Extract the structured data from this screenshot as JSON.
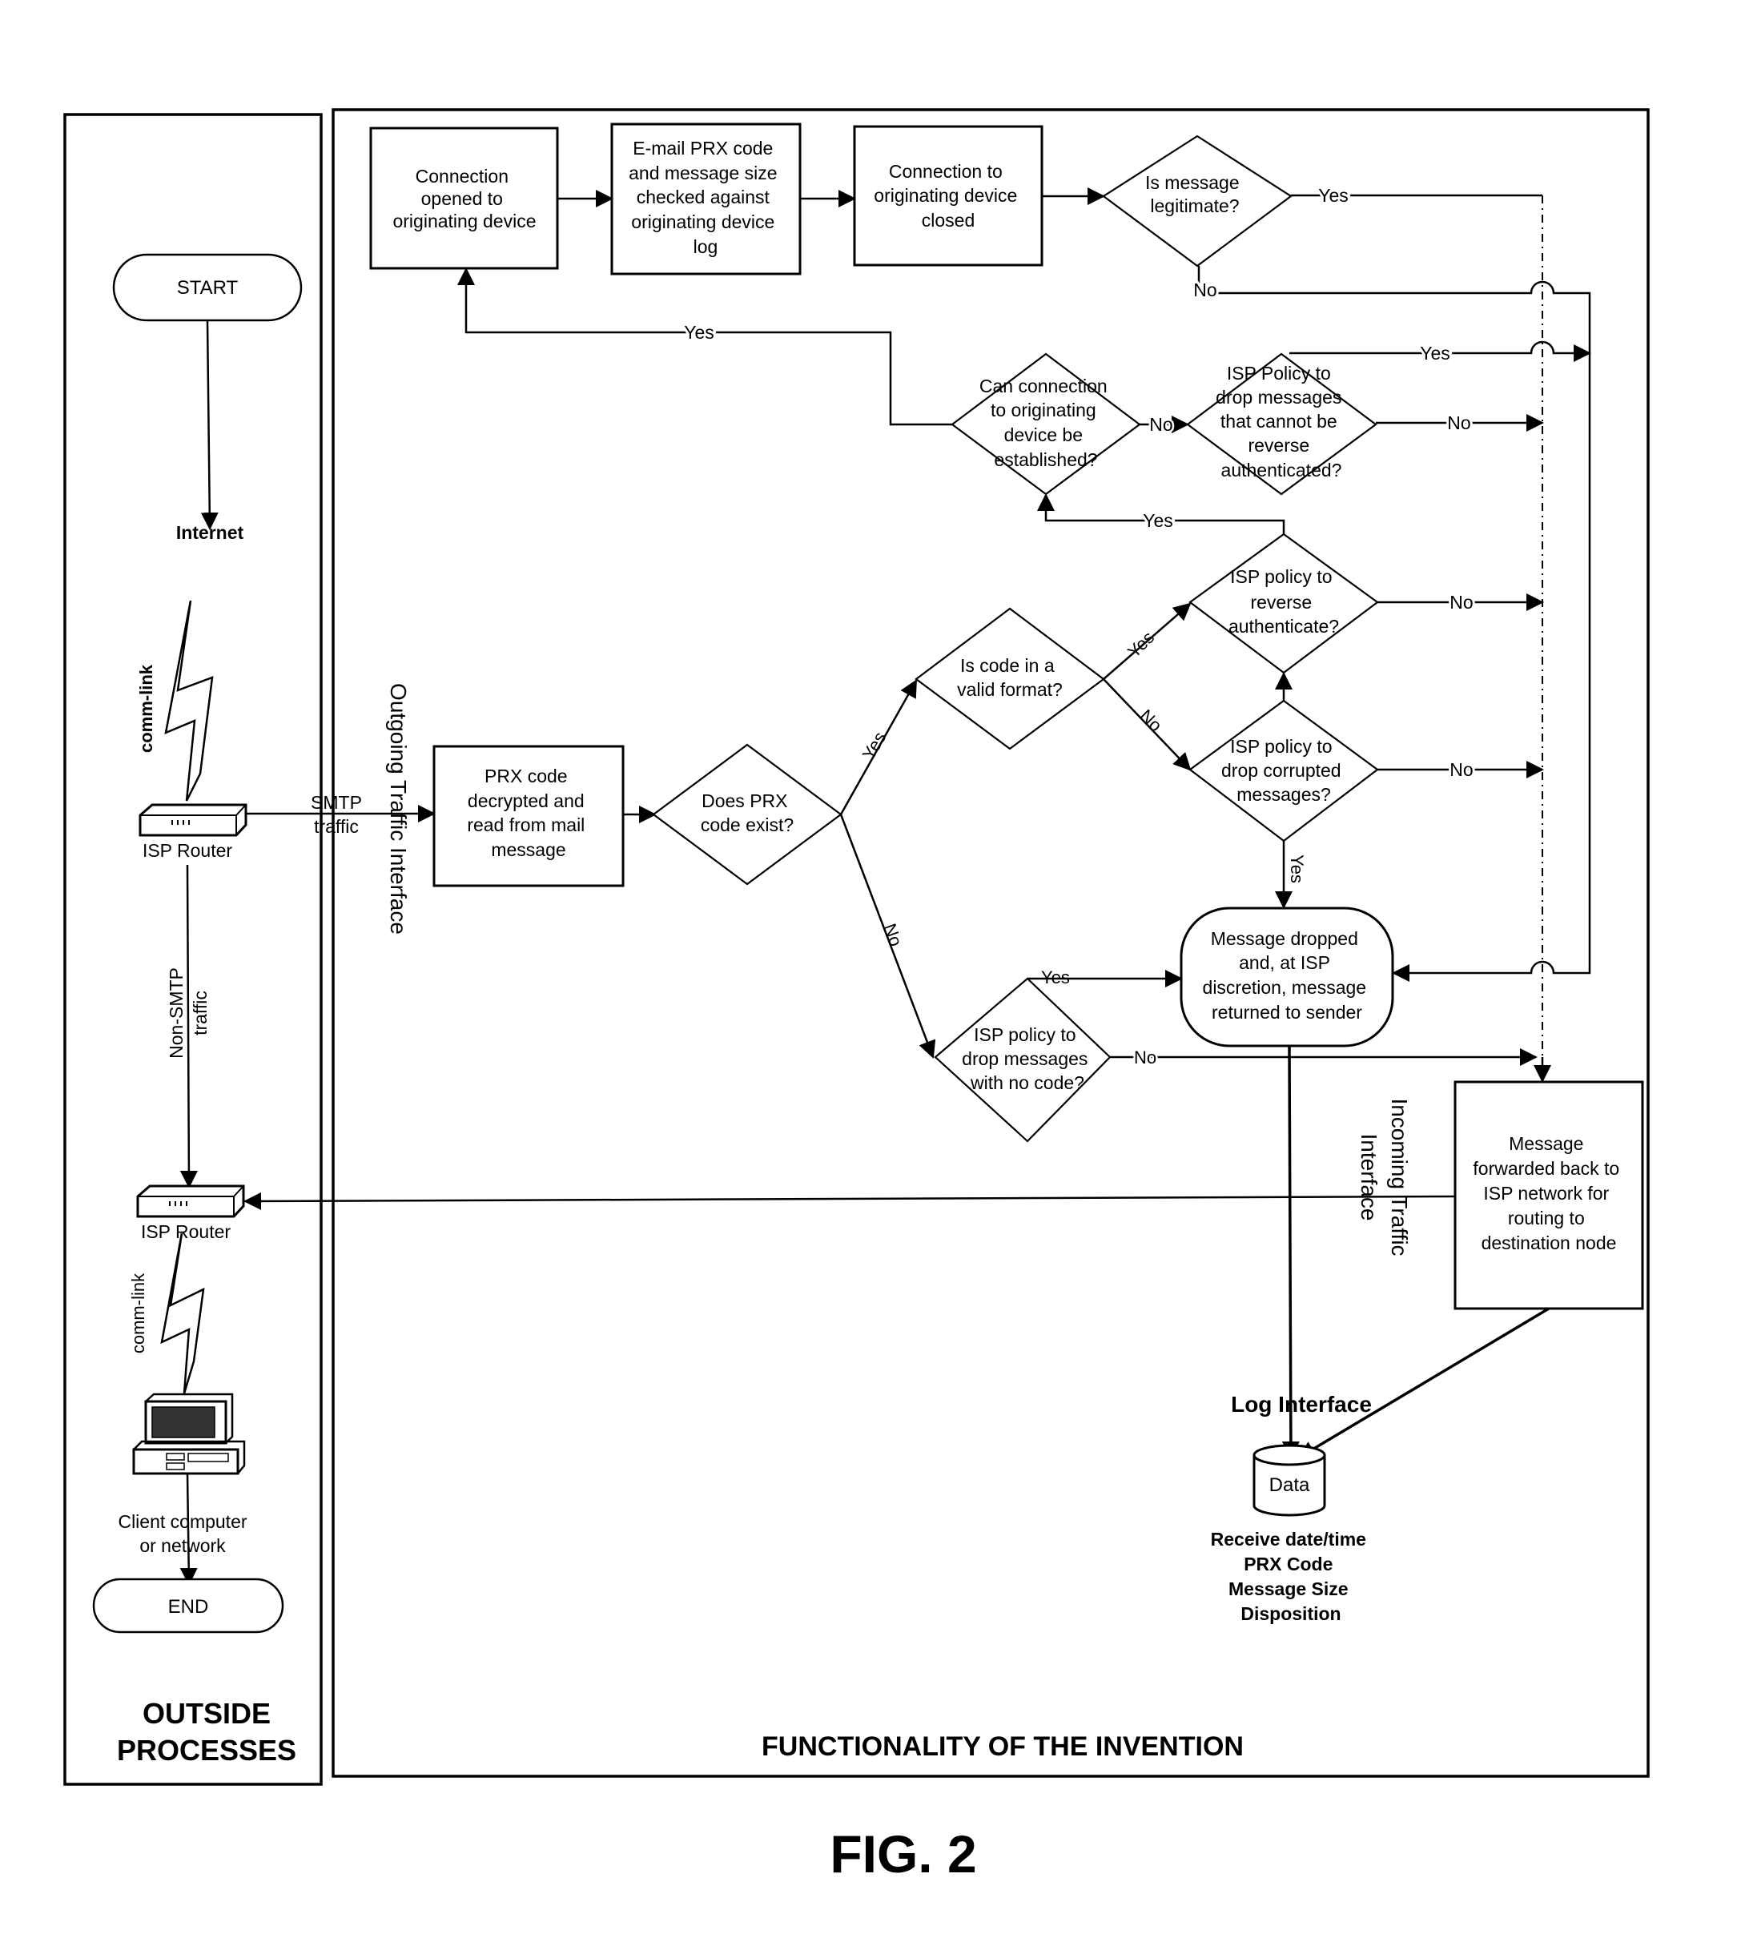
{
  "figure": {
    "caption": "FIG. 2",
    "panels": {
      "outside": {
        "title_line1": "OUTSIDE",
        "title_line2": "PROCESSES"
      },
      "invention": {
        "title": "FUNCTIONALITY OF THE INVENTION"
      }
    }
  },
  "outside": {
    "start": "START",
    "end": "END",
    "internet": "Internet",
    "comm_link_top": "comm-link",
    "comm_link_bottom": "comm-link",
    "router_top": "ISP Router",
    "router_bottom": "ISP Router",
    "smtp_traffic": [
      "SMTP",
      "traffic"
    ],
    "non_smtp_traffic": [
      "Non-SMTP",
      "traffic"
    ],
    "client": [
      "Client computer",
      "or network"
    ]
  },
  "interfaces": {
    "outgoing": "Outgoing Traffic Interface",
    "incoming": [
      "Incoming Traffic",
      "Interface"
    ],
    "log": "Log Interface"
  },
  "nodes": {
    "conn_opened": [
      "Connection",
      "opened to",
      "originating device"
    ],
    "email_check": [
      "E-mail PRX code",
      "and message size",
      "checked against",
      "originating device",
      "log"
    ],
    "conn_closed": [
      "Connection to",
      "originating device",
      "closed"
    ],
    "legit": [
      "Is message",
      "legitimate?"
    ],
    "can_connect": [
      "Can connection",
      "to originating",
      "device be",
      "established?"
    ],
    "policy_drop_unauth": [
      "ISP Policy to",
      "drop messages",
      "that cannot be",
      "reverse",
      "authenticated?"
    ],
    "policy_reverse_auth": [
      "ISP policy to",
      "reverse",
      "authenticate?"
    ],
    "valid_format": [
      "Is code in a",
      "valid format?"
    ],
    "policy_drop_corrupt": [
      "ISP policy to",
      "drop corrupted",
      "messages?"
    ],
    "prx_decrypt": [
      "PRX code",
      "decrypted and",
      "read from mail",
      "message"
    ],
    "prx_exist": [
      "Does PRX",
      "code exist?"
    ],
    "msg_dropped": [
      "Message dropped",
      "and, at ISP",
      "discretion,  message",
      "returned to sender"
    ],
    "policy_no_code": [
      "ISP policy to",
      "drop messages",
      "with no code?"
    ],
    "msg_forwarded": [
      "Message",
      "forwarded back to",
      "ISP network for",
      "routing to",
      "destination node"
    ],
    "data_store": "Data",
    "log_fields": [
      "Receive date/time",
      "PRX Code",
      "Message Size",
      "Disposition"
    ]
  },
  "labels": {
    "yes": "Yes",
    "no": "No"
  }
}
